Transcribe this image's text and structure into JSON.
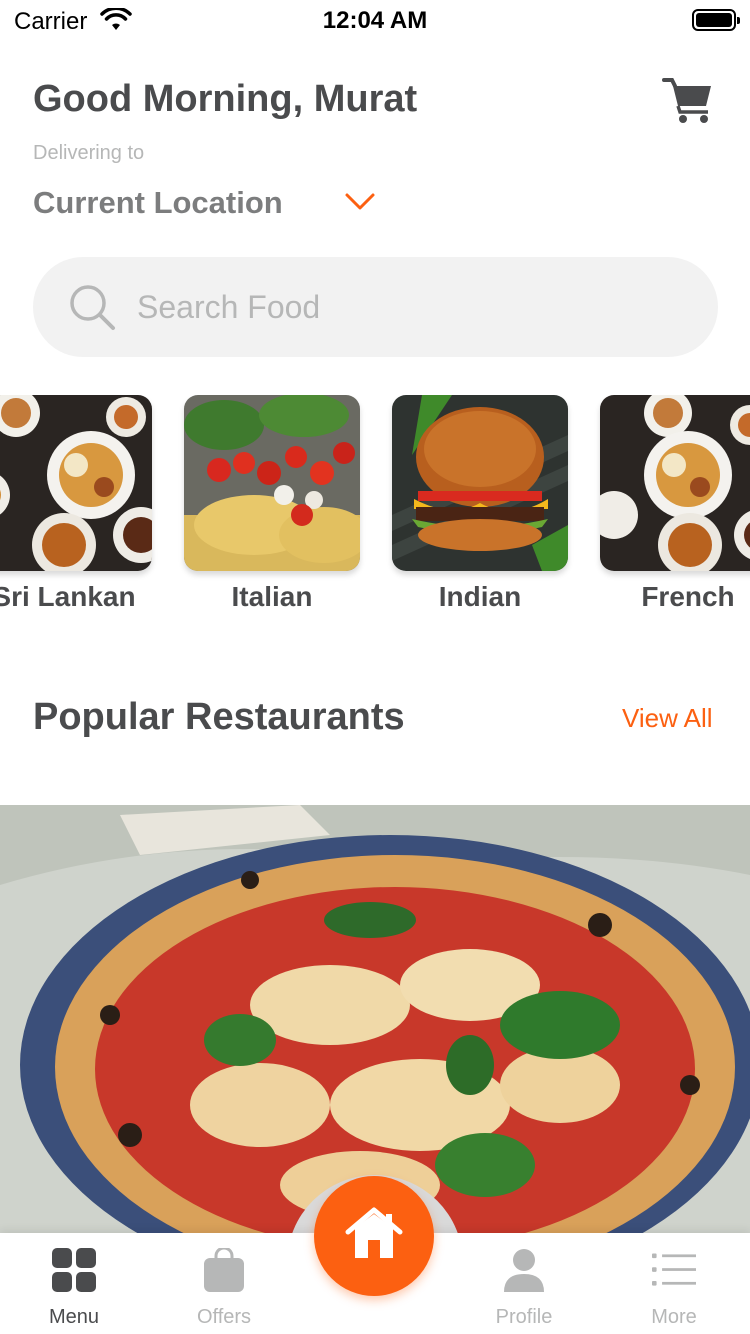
{
  "status_bar": {
    "carrier": "Carrier",
    "time": "12:04 AM"
  },
  "header": {
    "greeting": "Good Morning, Murat",
    "delivering_label": "Delivering to",
    "location": "Current Location"
  },
  "search": {
    "placeholder": "Search Food"
  },
  "categories": [
    {
      "label": "Sri Lankan"
    },
    {
      "label": "Italian"
    },
    {
      "label": "Indian"
    },
    {
      "label": "French"
    }
  ],
  "popular": {
    "title": "Popular Restaurants",
    "view_all": "View All"
  },
  "tabbar": {
    "items": [
      {
        "label": "Menu"
      },
      {
        "label": "Offers"
      },
      {
        "label": "Profile"
      },
      {
        "label": "More"
      }
    ]
  },
  "colors": {
    "accent": "#fc6011",
    "primary_text": "#4a4b4d",
    "secondary_text": "#7c7d7e",
    "placeholder": "#b6b7b7",
    "search_bg": "#f2f2f2"
  }
}
